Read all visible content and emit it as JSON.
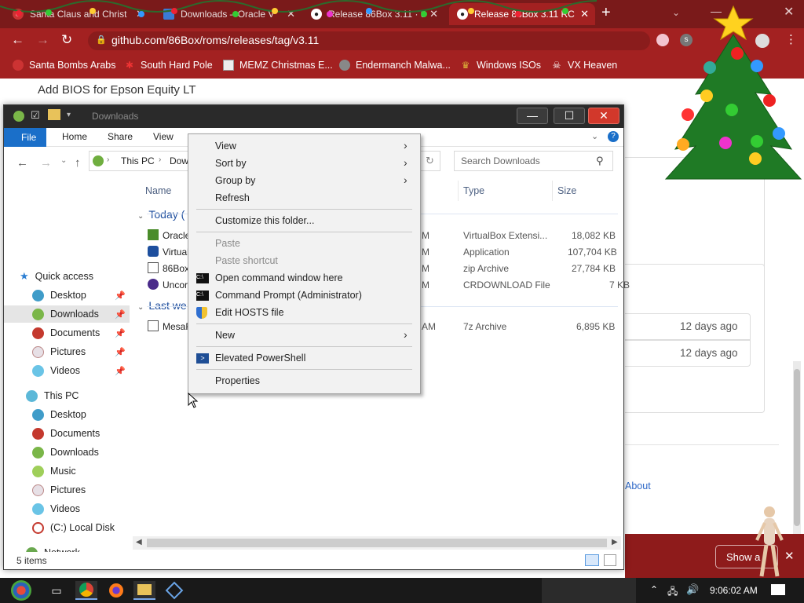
{
  "browser": {
    "tabs": [
      {
        "title": "Santa Claus and Christ",
        "icon": "santa-favicon"
      },
      {
        "title": "Downloads – Oracle V",
        "icon": "oracle-favicon"
      },
      {
        "title": "Release 86Box 3.11 · 8",
        "icon": "github-favicon"
      },
      {
        "title": "Release 86Box 3.11 RC",
        "icon": "github-favicon",
        "active": true
      }
    ],
    "url": "github.com/86Box/roms/releases/tag/v3.11",
    "bookmarks": [
      {
        "label": "Santa Bombs Arabs",
        "icon": "santa-icon"
      },
      {
        "label": "South Hard Pole",
        "icon": "snowflake-icon"
      },
      {
        "label": "MEMZ Christmas E...",
        "icon": "image-icon"
      },
      {
        "label": "Endermanch Malwa...",
        "icon": "raccoon-icon"
      },
      {
        "label": "Windows ISOs",
        "icon": "figure-icon"
      },
      {
        "label": "VX Heaven",
        "icon": "skull-icon"
      }
    ],
    "accent": "#a32121"
  },
  "github": {
    "commit_text": "Add BIOS for Epson Equity LT",
    "asset_dates": [
      "12 days ago",
      "12 days ago"
    ],
    "about_link": "About",
    "banner_button": "Show a"
  },
  "explorer": {
    "title": "Downloads",
    "ribbon_tabs": [
      "File",
      "Home",
      "Share",
      "View"
    ],
    "breadcrumb": [
      "This PC",
      "Dow"
    ],
    "search_placeholder": "Search Downloads",
    "nav": {
      "quick_access": "Quick access",
      "quick_items": [
        "Desktop",
        "Downloads",
        "Documents",
        "Pictures",
        "Videos"
      ],
      "this_pc": "This PC",
      "pc_items": [
        "Desktop",
        "Documents",
        "Downloads",
        "Music",
        "Pictures",
        "Videos",
        "(C:) Local Disk"
      ],
      "network": "Network"
    },
    "columns": {
      "name": "Name",
      "type": "Type",
      "size": "Size"
    },
    "groups": [
      {
        "label": "Today (",
        "files": [
          {
            "name": "Oracle",
            "date_tail": "M",
            "type": "VirtualBox Extensi...",
            "size": "18,082 KB"
          },
          {
            "name": "Virtual",
            "date_tail": "M",
            "type": "Application",
            "size": "107,704 KB"
          },
          {
            "name": "86Box",
            "date_tail": "M",
            "type": "zip Archive",
            "size": "27,784 KB"
          },
          {
            "name": "Uncor",
            "date_tail": "M",
            "type": "CRDOWNLOAD File",
            "size": "7 KB"
          }
        ]
      },
      {
        "label": "Last we",
        "files": [
          {
            "name": "MesaF",
            "date_tail": "AM",
            "type": "7z Archive",
            "size": "6,895 KB"
          }
        ]
      }
    ],
    "status": "5 items"
  },
  "context_menu": {
    "items": [
      {
        "label": "View",
        "submenu": true
      },
      {
        "label": "Sort by",
        "submenu": true
      },
      {
        "label": "Group by",
        "submenu": true
      },
      {
        "label": "Refresh"
      },
      {
        "label": "Customize this folder..."
      },
      {
        "label": "Paste",
        "disabled": true
      },
      {
        "label": "Paste shortcut",
        "disabled": true
      },
      {
        "label": "Open command window here",
        "icon": "cmd-icon"
      },
      {
        "label": "Command Prompt (Administrator)",
        "icon": "cmd-icon"
      },
      {
        "label": "Edit HOSTS file",
        "icon": "shield-icon"
      },
      {
        "label": "New",
        "submenu": true
      },
      {
        "label": "Elevated PowerShell",
        "icon": "powershell-icon"
      },
      {
        "label": "Properties"
      }
    ]
  },
  "taskbar": {
    "clock": "9:06:02 AM",
    "apps": [
      "start-button",
      "task-view-icon",
      "chrome-icon",
      "firefox-icon",
      "file-explorer-icon",
      "virtualbox-icon"
    ]
  }
}
